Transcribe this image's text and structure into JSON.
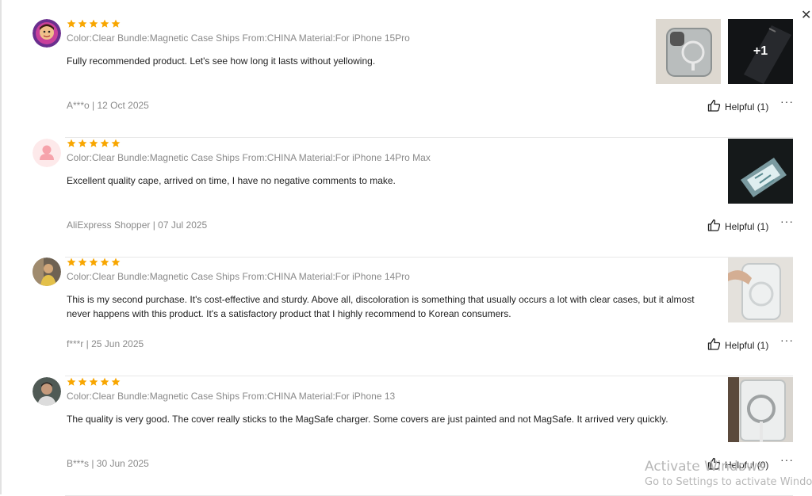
{
  "close_icon": "close-icon",
  "star_color": "#f8a600",
  "reviews": [
    {
      "avatar": "avatar-photo",
      "rating": 5,
      "meta": "Color:Clear Bundle:Magnetic Case Ships From:CHINA Material:For iPhone 15Pro",
      "text": "Fully recommended product. Let's see how long it lasts without yellowing.",
      "footer": "A***o | 12 Oct 2025",
      "helpful_label": "Helpful (1)",
      "more_label": "···",
      "photo_more_count": "+1"
    },
    {
      "avatar": "default-avatar",
      "rating": 5,
      "meta": "Color:Clear Bundle:Magnetic Case Ships From:CHINA Material:For iPhone 14Pro Max",
      "text": "Excellent quality cape, arrived on time, I have no negative comments to make.",
      "footer": "AliExpress Shopper | 07 Jul 2025",
      "helpful_label": "Helpful (1)",
      "more_label": "···"
    },
    {
      "avatar": "avatar-photo",
      "rating": 5,
      "meta": "Color:Clear Bundle:Magnetic Case Ships From:CHINA Material:For iPhone 14Pro",
      "text": "This is my second purchase. It's cost-effective and sturdy. Above all, discoloration is something that usually occurs a lot with clear cases, but it almost never happens with this product. It's a satisfactory product that I highly recommend to Korean consumers.",
      "footer": "f***r | 25 Jun 2025",
      "helpful_label": "Helpful (1)",
      "more_label": "···"
    },
    {
      "avatar": "avatar-photo",
      "rating": 5,
      "meta": "Color:Clear Bundle:Magnetic Case Ships From:CHINA Material:For iPhone 13",
      "text": "The quality is very good. The cover really sticks to the MagSafe charger. Some covers are just painted and not MagSafe. It arrived very quickly.",
      "footer": "B***s | 30 Jun 2025",
      "helpful_label": "Helpful (0)",
      "more_label": "···"
    }
  ],
  "watermark": {
    "title": "Activate Windows",
    "subtitle": "Go to Settings to activate Windows."
  }
}
